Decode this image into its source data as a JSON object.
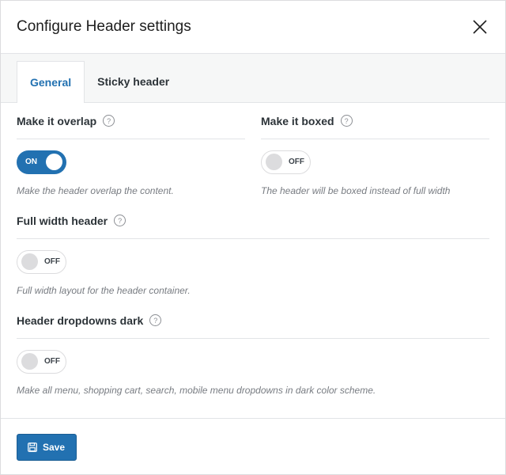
{
  "modal": {
    "title": "Configure Header settings",
    "close_icon": "close-icon"
  },
  "tabs": [
    {
      "label": "General",
      "active": true
    },
    {
      "label": "Sticky header",
      "active": false
    }
  ],
  "fields": {
    "overlap": {
      "label": "Make it overlap",
      "state": "ON",
      "description": "Make the header overlap the content."
    },
    "boxed": {
      "label": "Make it boxed",
      "state": "OFF",
      "description": "The header will be boxed instead of full width"
    },
    "full_width": {
      "label": "Full width header",
      "state": "OFF",
      "description": "Full width layout for the header container."
    },
    "dropdowns_dark": {
      "label": "Header dropdowns dark",
      "state": "OFF",
      "description": "Make all menu, shopping cart, search, mobile menu dropdowns in dark color scheme."
    }
  },
  "help_glyph": "?",
  "footer": {
    "save_label": "Save",
    "save_icon": "floppy-disk-icon"
  },
  "colors": {
    "accent": "#2271b1",
    "description_text": "#787c82"
  }
}
